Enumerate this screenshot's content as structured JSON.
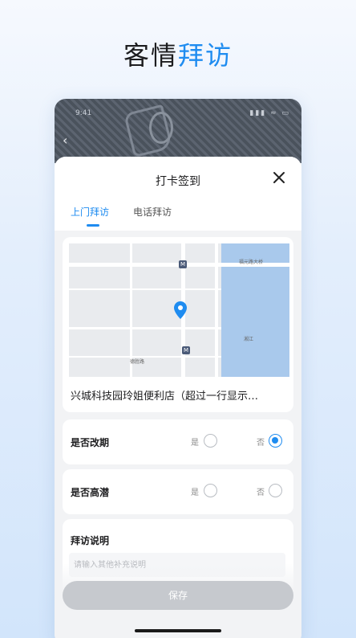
{
  "headline": {
    "prefix": "客情",
    "accent": "拜访"
  },
  "status_bar": {
    "time": "9:41",
    "icons": "▮▮▮ ≈ ▭"
  },
  "sheet": {
    "title": "打卡签到",
    "tabs": [
      {
        "label": "上门拜访",
        "active": true
      },
      {
        "label": "电话拜访",
        "active": false
      }
    ]
  },
  "map": {
    "labels": [
      "福元路大桥",
      "德胜路",
      "湘江"
    ],
    "metro_glyph": "M"
  },
  "address": "兴城科技园玲姐便利店（超过一行显示…",
  "questions": [
    {
      "label": "是否改期",
      "yes_label": "是",
      "no_label": "否",
      "selected": "no"
    },
    {
      "label": "是否高潜",
      "yes_label": "是",
      "no_label": "否",
      "selected": "none"
    }
  ],
  "description": {
    "title": "拜访说明",
    "placeholder": "请输入其他补充说明"
  },
  "save_label": "保存",
  "colors": {
    "accent": "#1f8cf0",
    "button_disabled": "#c6c9ce"
  },
  "icons": {
    "close": "close-icon",
    "back": "back-arrow-icon",
    "pin": "map-pin-icon"
  }
}
